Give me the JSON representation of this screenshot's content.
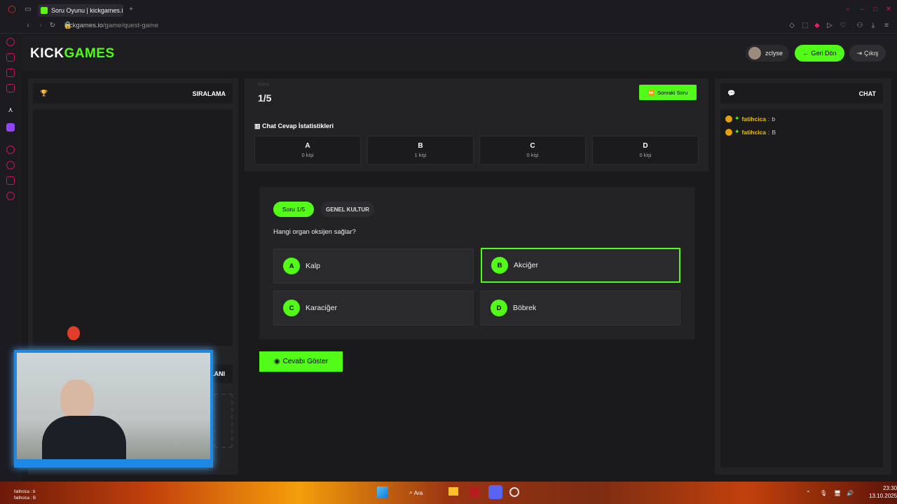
{
  "browser": {
    "tab_title": "Soru Oyunu | kickgames.i",
    "url_host": "kickgames.io",
    "url_path": "/game/quest-game",
    "new_tab": "+"
  },
  "header": {
    "logo_a": "KICK",
    "logo_b": "GAMES",
    "username": "zclyse",
    "back_label": "Geri Dön",
    "exit_label": "Çıkış"
  },
  "left": {
    "title": "SIRALAMA",
    "title2": "LANI"
  },
  "quiz": {
    "progress_small": "SIRA",
    "progress": "1/5",
    "next_label": "Sonraki Soru",
    "stats_title": "Chat Cevap İstatistikleri",
    "stats": [
      {
        "letter": "A",
        "count": "0 kişi"
      },
      {
        "letter": "B",
        "count": "1 kişi"
      },
      {
        "letter": "C",
        "count": "0 kişi"
      },
      {
        "letter": "D",
        "count": "0 kişi"
      }
    ],
    "badge": "Soru 1/5",
    "category": "GENEL KULTUR",
    "question": "Hangi organ oksijen sağlar?",
    "options": [
      {
        "letter": "A",
        "text": "Kalp"
      },
      {
        "letter": "B",
        "text": "Akciğer"
      },
      {
        "letter": "C",
        "text": "Karaciğer"
      },
      {
        "letter": "D",
        "text": "Böbrek"
      }
    ],
    "selected": "B",
    "show_answer": "Cevabı Göster"
  },
  "chat": {
    "title": "CHAT",
    "messages": [
      {
        "user": "fatihcica",
        "text": "b"
      },
      {
        "user": "fatihcica",
        "text": "B"
      }
    ]
  },
  "taskbar": {
    "search": "Ara",
    "time": "23:30",
    "date": "13.10.2025",
    "overlay_1": "fatihcica : b",
    "overlay_2": "fatihcica : B"
  },
  "colors": {
    "accent": "#53fc18",
    "bg": "#1a1a1d",
    "panel": "#232326"
  }
}
